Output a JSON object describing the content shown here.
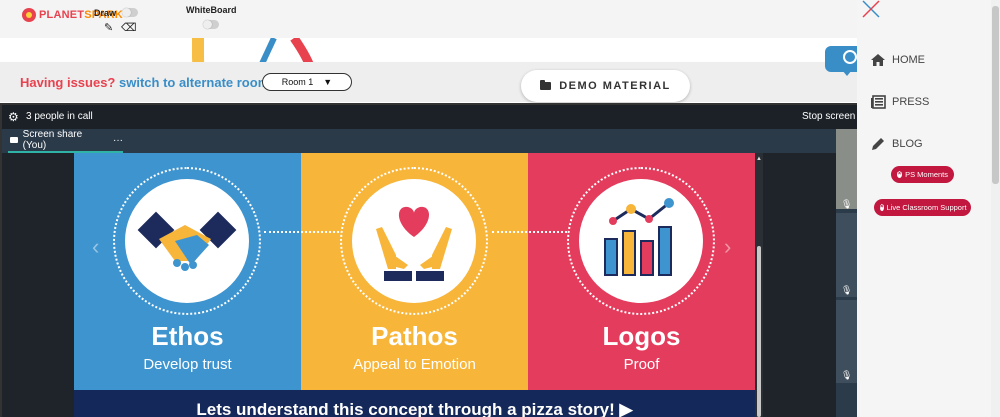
{
  "brand": {
    "part1": "PLANET",
    "part2": "SPARK"
  },
  "toolbar": {
    "draw_label": "Draw",
    "whiteboard_label": "WhiteBoard",
    "pencil_icon": "pencil-icon",
    "eraser_icon": "eraser-icon"
  },
  "issues": {
    "question": "Having issues?",
    "link_text": "switch to alternate room",
    "room_value": "Room 1"
  },
  "demo_button": {
    "label": "DEMO MATERIAL"
  },
  "call": {
    "people_count": "3 people in call",
    "stop_label": "Stop screen",
    "tab_label": "Screen share (You)",
    "tab_more": "···"
  },
  "slide": {
    "panels": [
      {
        "title": "Ethos",
        "subtitle": "Develop trust",
        "color": "#3e94cf"
      },
      {
        "title": "Pathos",
        "subtitle": "Appeal to Emotion",
        "color": "#f7b53a"
      },
      {
        "title": "Logos",
        "subtitle": "Proof",
        "color": "#e43c5d"
      }
    ],
    "banner": "Lets understand this concept through a pizza story! ▶"
  },
  "sidebar": {
    "home": "HOME",
    "press": "PRESS",
    "blog": "BLOG",
    "moments": "PS Moments",
    "support": "Live Classroom Support"
  },
  "colors": {
    "accent_red": "#e8424f",
    "link_blue": "#3a8ec8",
    "pill_red": "#c2173f",
    "call_bg": "#1b2127"
  }
}
